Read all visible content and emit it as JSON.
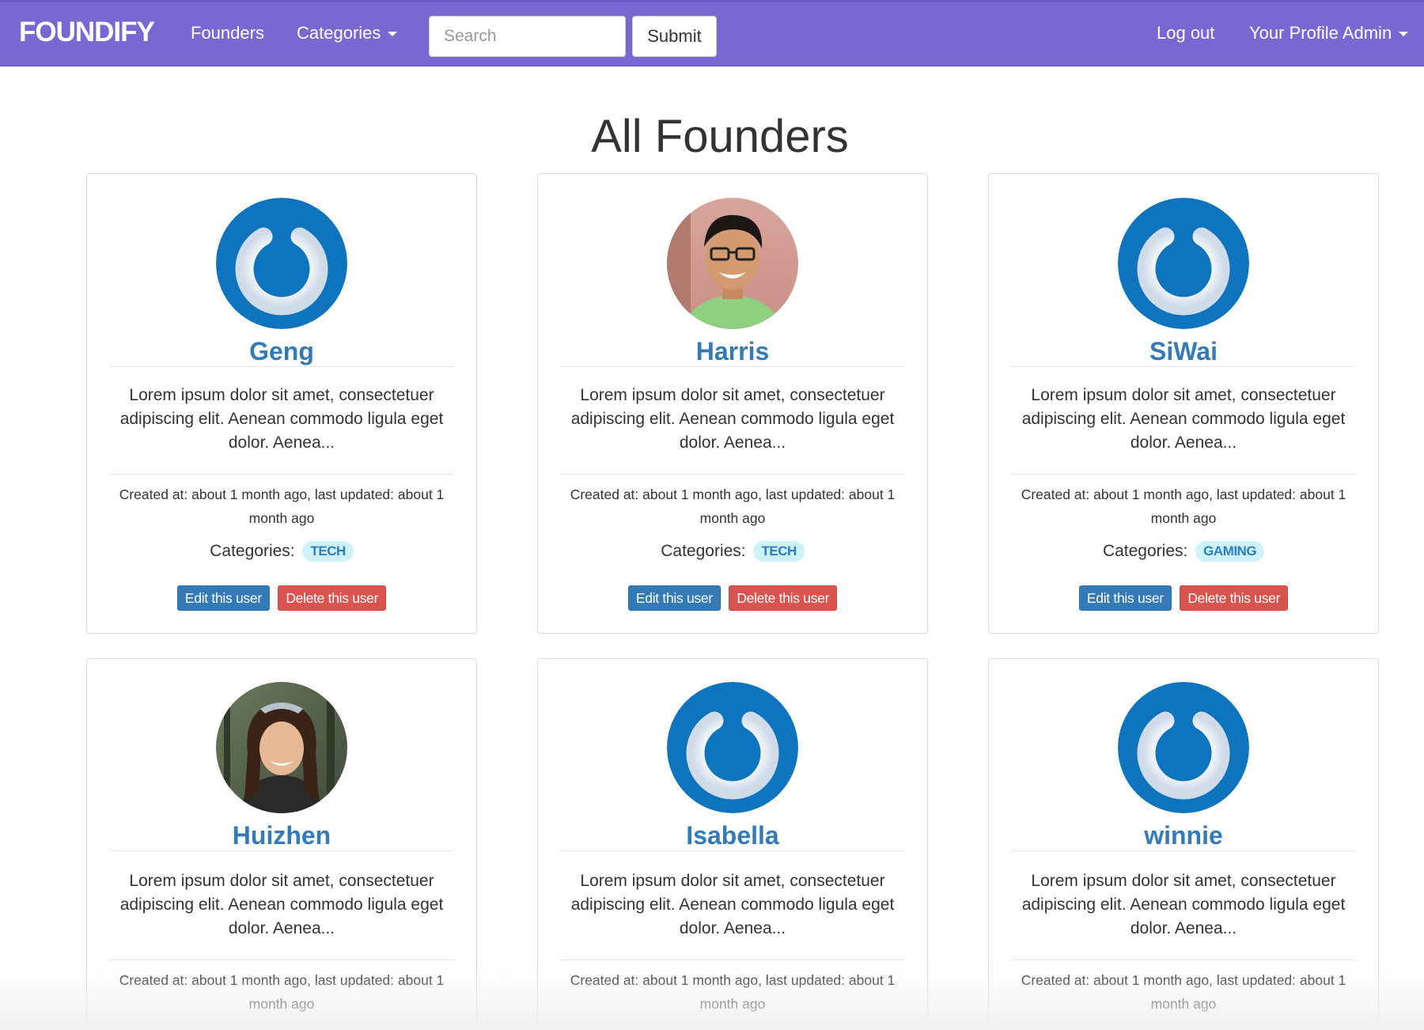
{
  "navbar": {
    "brand": "FOUNDIFY",
    "founders": "Founders",
    "categories": "Categories",
    "search_placeholder": "Search",
    "submit": "Submit",
    "logout": "Log out",
    "profile": "Your Profile Admin"
  },
  "main": {
    "title": "All Founders"
  },
  "labels": {
    "categories": "Categories:",
    "edit": "Edit this user",
    "delete": "Delete this user"
  },
  "founders": [
    {
      "name": "Geng",
      "avatar": "power-logo-avatar",
      "description": "Lorem ipsum dolor sit amet, consectetuer adipiscing elit. Aenean commodo ligula eget dolor. Aenea...",
      "meta": "Created at: about 1 month ago, last updated: about 1 month ago",
      "category": "TECH"
    },
    {
      "name": "Harris",
      "avatar": "photo-avatar",
      "description": "Lorem ipsum dolor sit amet, consectetuer adipiscing elit. Aenean commodo ligula eget dolor. Aenea...",
      "meta": "Created at: about 1 month ago, last updated: about 1 month ago",
      "category": "TECH"
    },
    {
      "name": "SiWai",
      "avatar": "power-logo-avatar",
      "description": "Lorem ipsum dolor sit amet, consectetuer adipiscing elit. Aenean commodo ligula eget dolor. Aenea...",
      "meta": "Created at: about 1 month ago, last updated: about 1 month ago",
      "category": "GAMING"
    },
    {
      "name": "Huizhen",
      "avatar": "photo-avatar",
      "description": "Lorem ipsum dolor sit amet, consectetuer adipiscing elit. Aenean commodo ligula eget dolor. Aenea...",
      "meta": "Created at: about 1 month ago, last updated: about 1 month ago"
    },
    {
      "name": "Isabella",
      "avatar": "power-logo-avatar",
      "description": "Lorem ipsum dolor sit amet, consectetuer adipiscing elit. Aenean commodo ligula eget dolor. Aenea...",
      "meta": "Created at: about 1 month ago, last updated: about 1 month ago"
    },
    {
      "name": "winnie",
      "avatar": "power-logo-avatar",
      "description": "Lorem ipsum dolor sit amet, consectetuer adipiscing elit. Aenean commodo ligula eget dolor. Aenea...",
      "meta": "Created at: about 1 month ago, last updated: about 1 month ago"
    }
  ],
  "colors": {
    "navbar": "#7768d2",
    "link": "#337ab7",
    "edit": "#337ab7",
    "delete": "#d9534f",
    "badge_bg": "#cdf3f8",
    "logo_blue": "#0d74bd"
  }
}
